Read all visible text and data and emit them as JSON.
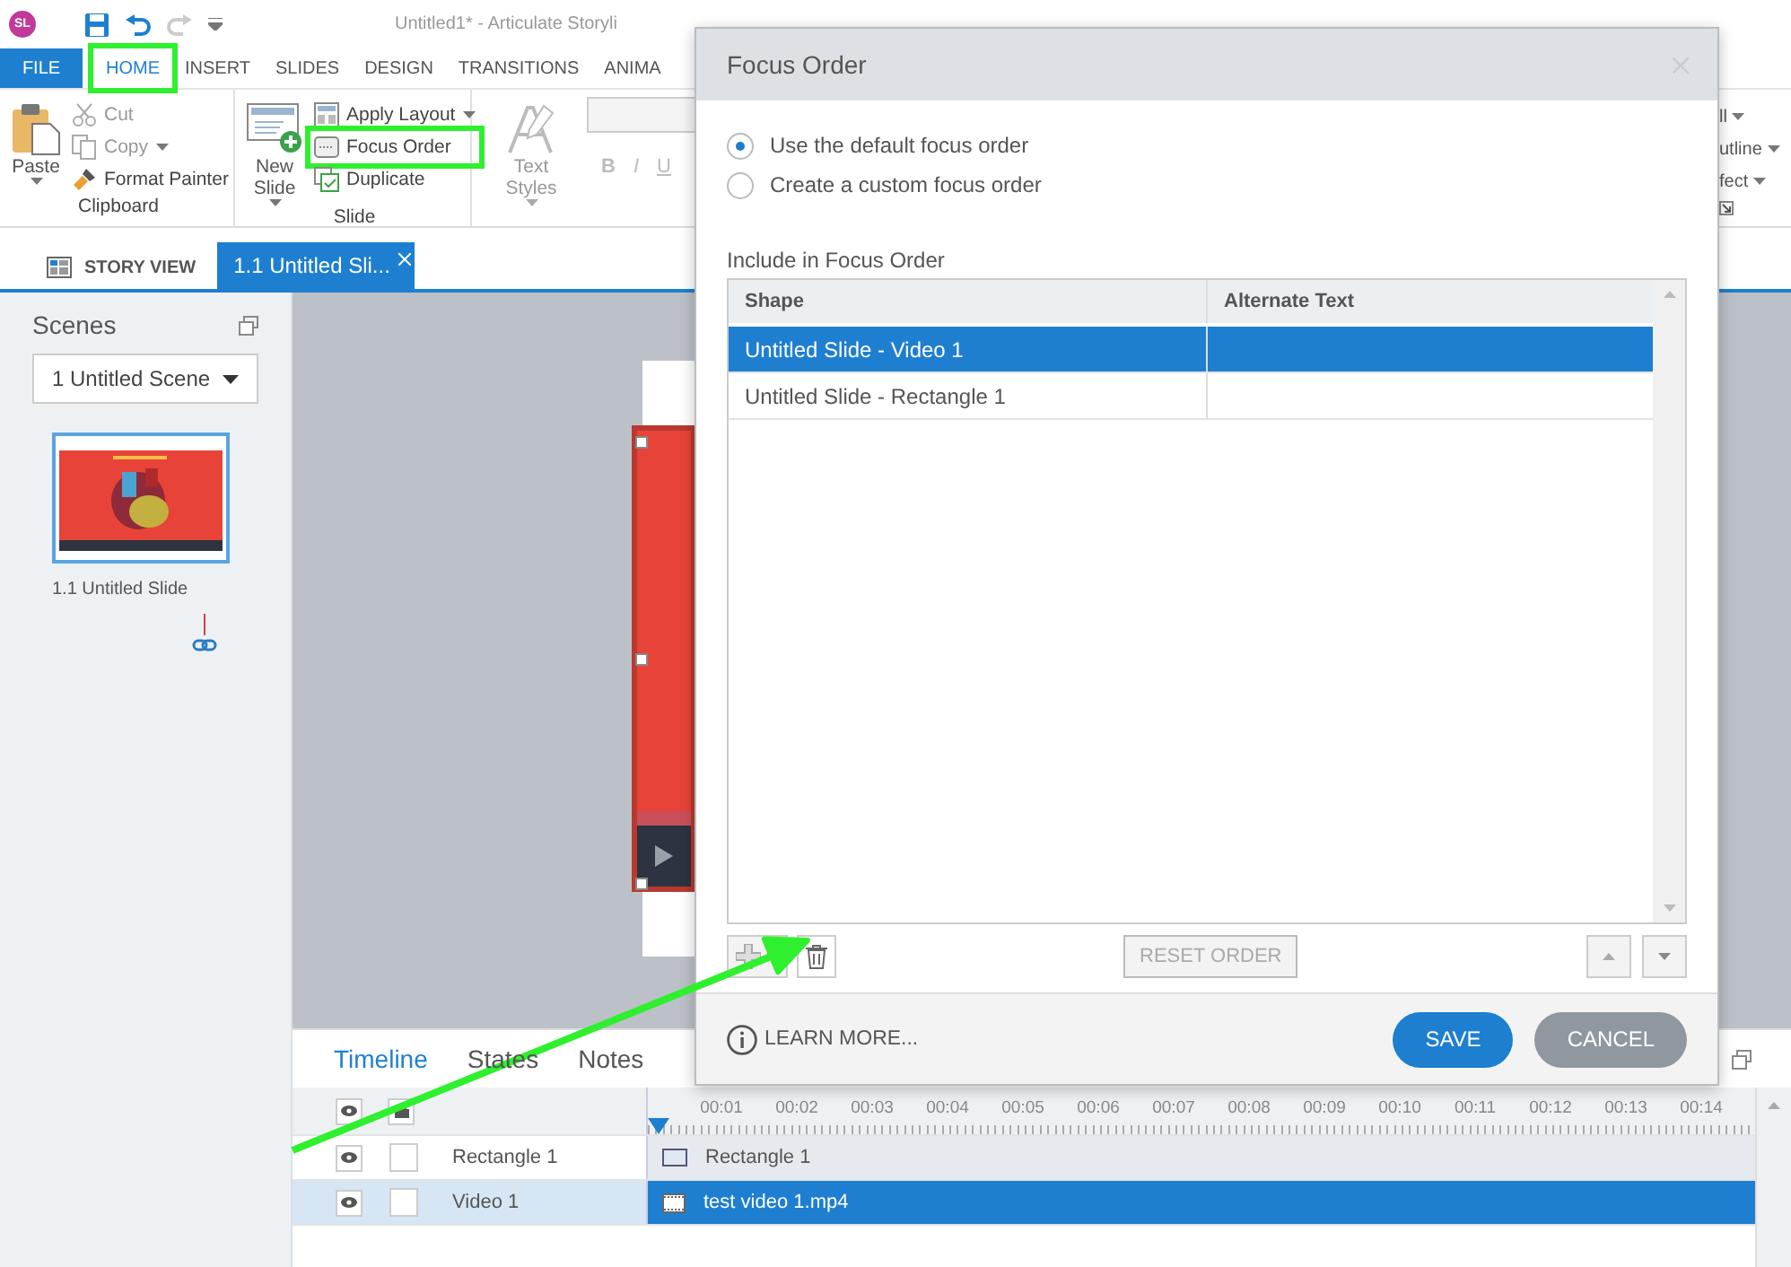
{
  "app": {
    "logo": "SL",
    "title": "Untitled1* - Articulate Storyli"
  },
  "ribbon_tabs": [
    {
      "label": "FILE",
      "kind": "file",
      "selected": false,
      "highlighted": false
    },
    {
      "label": "HOME",
      "kind": "tab",
      "selected": true,
      "highlighted": true
    },
    {
      "label": "INSERT",
      "kind": "tab",
      "selected": false,
      "highlighted": false
    },
    {
      "label": "SLIDES",
      "kind": "tab",
      "selected": false,
      "highlighted": false
    },
    {
      "label": "DESIGN",
      "kind": "tab",
      "selected": false,
      "highlighted": false
    },
    {
      "label": "TRANSITIONS",
      "kind": "tab",
      "selected": false,
      "highlighted": false
    },
    {
      "label": "ANIMA",
      "kind": "tab",
      "selected": false,
      "highlighted": false
    }
  ],
  "ribbon_groups": [
    {
      "label": "Clipboard",
      "big": {
        "label": "Paste",
        "dropdown": true,
        "disabled": false
      },
      "items": [
        {
          "label": "Cut",
          "dropdown": false,
          "disabled": true,
          "highlighted": false
        },
        {
          "label": "Copy",
          "dropdown": true,
          "disabled": true,
          "highlighted": false
        },
        {
          "label": "Format Painter",
          "dropdown": false,
          "disabled": false,
          "highlighted": false
        }
      ]
    },
    {
      "label": "Slide",
      "big": {
        "label": "New Slide",
        "dropdown": true,
        "disabled": false
      },
      "items": [
        {
          "label": "Apply Layout",
          "dropdown": true,
          "disabled": false,
          "highlighted": false
        },
        {
          "label": "Focus Order",
          "dropdown": false,
          "disabled": false,
          "highlighted": true
        },
        {
          "label": "Duplicate",
          "dropdown": false,
          "disabled": false,
          "highlighted": false
        }
      ]
    }
  ],
  "text_group": {
    "big": {
      "label": "Text Styles",
      "dropdown": true,
      "disabled": true
    },
    "format_buttons": [
      "B",
      "I",
      "U"
    ]
  },
  "ribbon_right_items": [
    "ll",
    "utline",
    "fect"
  ],
  "doc_tabs": [
    {
      "label": "STORY VIEW",
      "kind": "story",
      "selected": false
    },
    {
      "label": "1.1 Untitled Sli...",
      "kind": "slide",
      "selected": true
    }
  ],
  "scenes": {
    "title": "Scenes",
    "dropdown": "1 Untitled Scene",
    "slides": [
      {
        "label": "1.1 Untitled Slide",
        "selected": true
      }
    ]
  },
  "timeline": {
    "tabs": [
      {
        "label": "Timeline",
        "selected": true
      },
      {
        "label": "States",
        "selected": false
      },
      {
        "label": "Notes",
        "selected": false
      }
    ],
    "ticks": [
      "00:01",
      "00:02",
      "00:03",
      "00:04",
      "00:05",
      "00:06",
      "00:07",
      "00:08",
      "00:09",
      "00:10",
      "00:11",
      "00:12",
      "00:13",
      "00:14"
    ],
    "rows": [
      {
        "name": "Rectangle 1",
        "bar": "Rectangle 1",
        "kind": "shape",
        "selected": false
      },
      {
        "name": "Video 1",
        "bar": "test video 1.mp4",
        "kind": "video",
        "selected": true
      }
    ]
  },
  "dialog": {
    "title": "Focus Order",
    "options": [
      {
        "label": "Use the default focus order",
        "selected": true
      },
      {
        "label": "Create a custom focus order",
        "selected": false
      }
    ],
    "list_label": "Include in Focus Order",
    "columns": [
      "Shape",
      "Alternate Text"
    ],
    "rows": [
      {
        "shape": "Untitled Slide - Video 1",
        "selected": true
      },
      {
        "shape": "Untitled Slide - Rectangle 1",
        "selected": false
      }
    ],
    "reset_button": {
      "label": "RESET ORDER",
      "disabled": true
    },
    "learn_more": "LEARN MORE...",
    "buttons": [
      {
        "label": "SAVE",
        "kind": "primary"
      },
      {
        "label": "CANCEL",
        "kind": "secondary"
      }
    ]
  }
}
